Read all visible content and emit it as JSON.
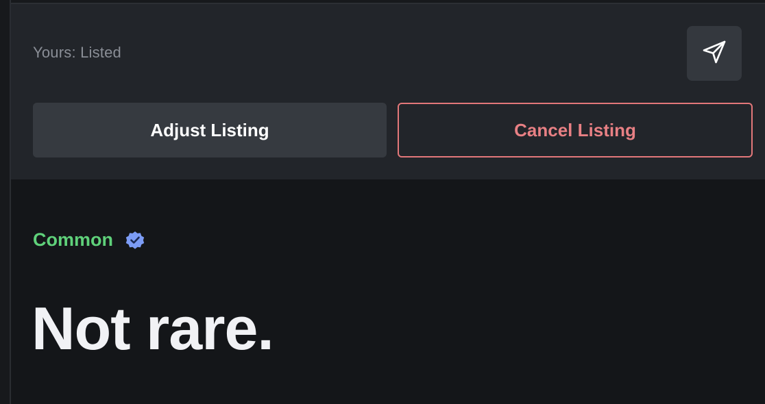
{
  "listing": {
    "status_text": "Yours: Listed",
    "share_icon": "send-icon",
    "adjust_label": "Adjust Listing",
    "cancel_label": "Cancel Listing"
  },
  "item": {
    "rarity_label": "Common",
    "verified_icon": "verified-badge-icon",
    "headline": "Not rare."
  },
  "colors": {
    "panel_bg": "#22252a",
    "page_bg": "#141619",
    "cancel_accent": "#e88084",
    "rarity_green": "#5fd17a",
    "verified_blue": "#7c9cf5"
  }
}
